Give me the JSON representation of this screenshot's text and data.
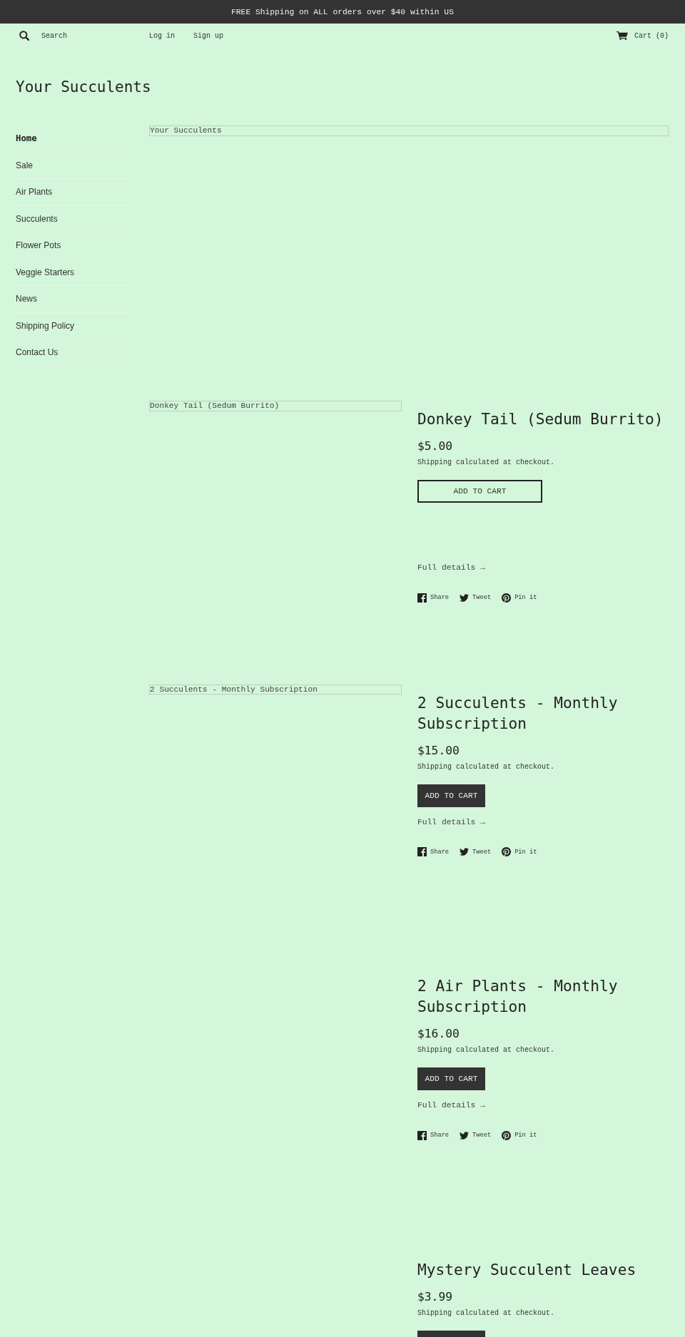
{
  "announcement_bar": {
    "text": "FREE Shipping on ALL orders over $40 within US"
  },
  "header": {
    "search": {
      "placeholder": "Search"
    },
    "links": [
      "Log in",
      "Sign up"
    ],
    "cart": {
      "label": "Cart (0)"
    }
  },
  "store_title": "Your Succulents",
  "sidebar": {
    "items": [
      {
        "label": "Home",
        "selected": true
      },
      {
        "label": "Sale",
        "selected": false
      },
      {
        "label": "Air Plants",
        "selected": false
      },
      {
        "label": "Succulents",
        "selected": false
      },
      {
        "label": "Flower Pots",
        "selected": false
      },
      {
        "label": "Veggie Starters",
        "selected": false
      },
      {
        "label": "News",
        "selected": false
      },
      {
        "label": "Shipping Policy",
        "selected": false
      },
      {
        "label": "Contact Us",
        "selected": false
      }
    ]
  },
  "hero": {
    "image_alt": "Your Succulents"
  },
  "products": [
    {
      "image_alt": "Donkey Tail (Sedum Burrito)",
      "title": "Donkey Tail (Sedum Burrito)",
      "price": "$5.00",
      "shipping_note": "Shipping calculated at checkout.",
      "button": {
        "kind": "outline",
        "label": "ADD TO CART"
      },
      "details_link": "Full details →",
      "share": [
        {
          "kind": "facebook",
          "label": "Share"
        },
        {
          "kind": "twitter",
          "label": "Tweet"
        },
        {
          "kind": "pinterest",
          "label": "Pin it"
        }
      ]
    },
    {
      "image_alt": "2 Succulents - Monthly Subscription",
      "title": "2 Succulents - Monthly Subscription",
      "price": "$15.00",
      "shipping_note": "Shipping calculated at checkout.",
      "button": {
        "kind": "solid",
        "label": "ADD TO CART"
      },
      "details_link": "Full details →",
      "share": [
        {
          "kind": "facebook",
          "label": "Share"
        },
        {
          "kind": "twitter",
          "label": "Tweet"
        },
        {
          "kind": "pinterest",
          "label": "Pin it"
        }
      ]
    },
    {
      "title": "2 Air Plants - Monthly Subscription",
      "price": "$16.00",
      "shipping_note": "Shipping calculated at checkout.",
      "button": {
        "kind": "solid",
        "label": "ADD TO CART"
      },
      "details_link": "Full details →",
      "share": [
        {
          "kind": "facebook",
          "label": "Share"
        },
        {
          "kind": "twitter",
          "label": "Tweet"
        },
        {
          "kind": "pinterest",
          "label": "Pin it"
        }
      ]
    },
    {
      "title": "Mystery Succulent Leaves",
      "price": "$3.99",
      "shipping_note": "Shipping calculated at checkout.",
      "button": {
        "kind": "solid"
      }
    }
  ]
}
